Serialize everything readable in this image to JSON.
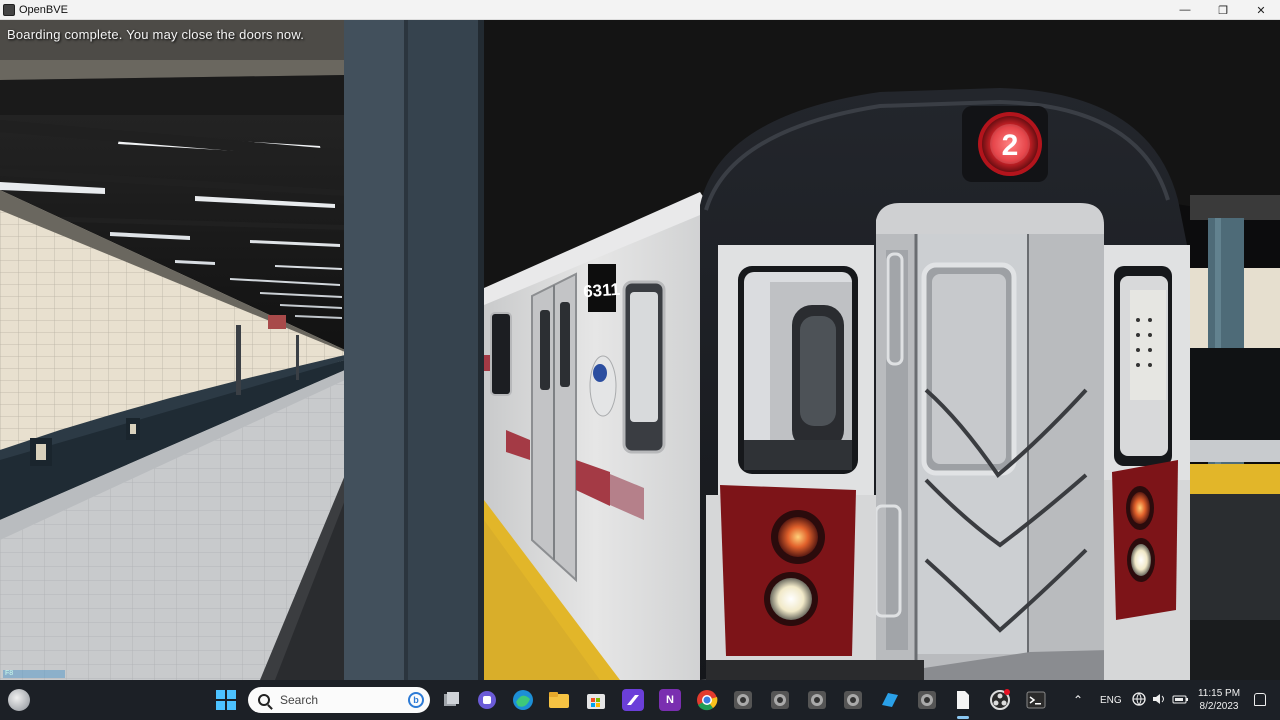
{
  "window": {
    "title": "OpenBVE",
    "minimize_glyph": "—",
    "maximize_glyph": "❐",
    "close_glyph": "✕"
  },
  "scene": {
    "message": "Boarding complete. You may close the doors now.",
    "route_number": "2",
    "car_number": "6311",
    "hud_mini_label": "F8"
  },
  "taskbar": {
    "search_placeholder": "Search",
    "bing_glyph": "b",
    "onenote_glyph": "N",
    "language": "ENG",
    "time": "11:15 PM",
    "date": "8/2/2023",
    "tray_chevron": "⌃"
  },
  "colors": {
    "train_body": "#d8d9da",
    "train_cab": "#1b1d22",
    "route_bullet": "#e2262c",
    "platform_edge": "#e2b629",
    "taskbar_bg": "#1c2026",
    "accent": "#4cc2ff"
  },
  "icons": [
    "openbve-icon",
    "weather-icon",
    "windows-start-icon",
    "search-icon",
    "bing-icon",
    "file-explorer-icon",
    "teams-icon",
    "edge-icon",
    "folder-icon",
    "store-icon",
    "visual-studio-icon",
    "onenote-icon",
    "chrome-icon",
    "openbve-taskbar-icon",
    "terminal-icon",
    "network-icon",
    "volume-icon",
    "battery-icon",
    "notification-icon"
  ]
}
